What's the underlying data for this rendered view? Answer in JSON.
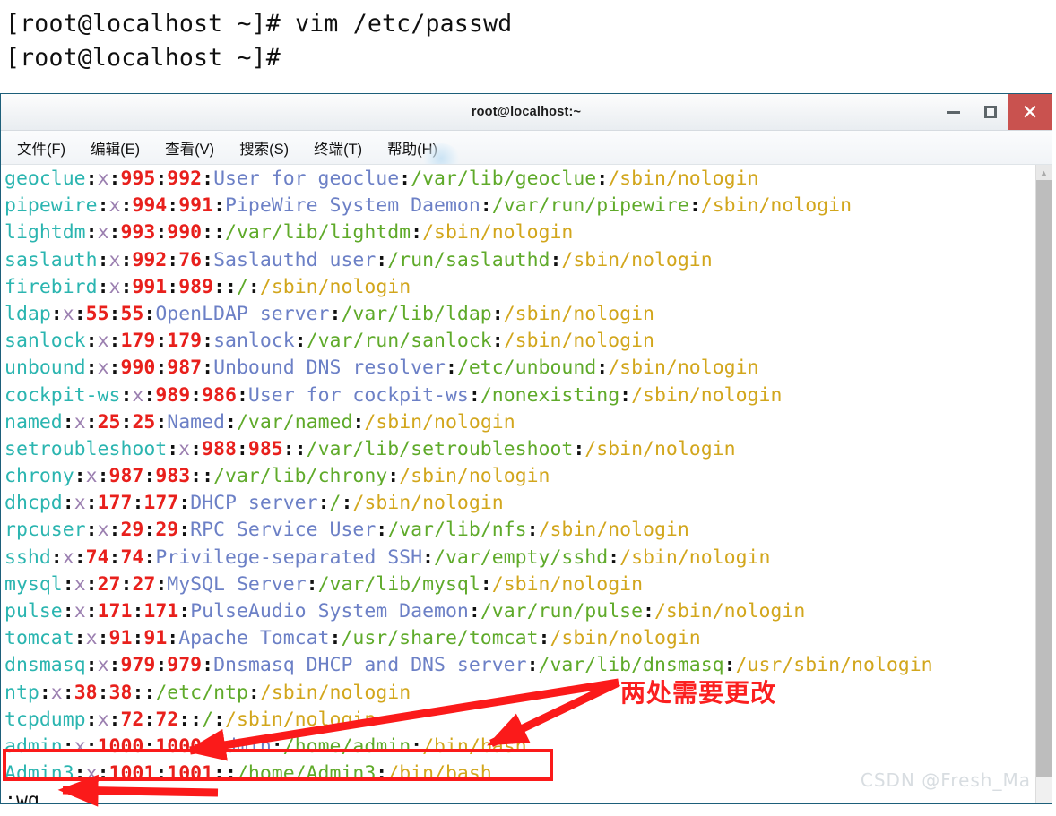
{
  "shell": {
    "line1": "[root@localhost ~]# vim /etc/passwd",
    "line2": "[root@localhost ~]#"
  },
  "window": {
    "title": "root@localhost:~",
    "controls": {
      "minimize": "─",
      "maximize": "□",
      "close": "✕"
    }
  },
  "menu": {
    "items": [
      {
        "label": "文件(F)"
      },
      {
        "label": "编辑(E)"
      },
      {
        "label": "查看(V)"
      },
      {
        "label": "搜索(S)"
      },
      {
        "label": "终端(T)"
      },
      {
        "label": "帮助(H)"
      }
    ]
  },
  "scrollbar": {
    "up_arrow": "▲"
  },
  "terminal": {
    "lines": [
      {
        "user": "geoclue",
        "pw": "x",
        "uid": "995",
        "gid": "992",
        "comment": "User for geoclue",
        "home": "/var/lib/geoclue",
        "shell": "/sbin/nologin"
      },
      {
        "user": "pipewire",
        "pw": "x",
        "uid": "994",
        "gid": "991",
        "comment": "PipeWire System Daemon",
        "home": "/var/run/pipewire",
        "shell": "/sbin/nologin"
      },
      {
        "user": "lightdm",
        "pw": "x",
        "uid": "993",
        "gid": "990",
        "comment": "",
        "home": "/var/lib/lightdm",
        "shell": "/sbin/nologin"
      },
      {
        "user": "saslauth",
        "pw": "x",
        "uid": "992",
        "gid": "76",
        "comment": "Saslauthd user",
        "home": "/run/saslauthd",
        "shell": "/sbin/nologin"
      },
      {
        "user": "firebird",
        "pw": "x",
        "uid": "991",
        "gid": "989",
        "comment": "",
        "home": "/",
        "shell": "/sbin/nologin"
      },
      {
        "user": "ldap",
        "pw": "x",
        "uid": "55",
        "gid": "55",
        "comment": "OpenLDAP server",
        "home": "/var/lib/ldap",
        "shell": "/sbin/nologin"
      },
      {
        "user": "sanlock",
        "pw": "x",
        "uid": "179",
        "gid": "179",
        "comment": "sanlock",
        "home": "/var/run/sanlock",
        "shell": "/sbin/nologin"
      },
      {
        "user": "unbound",
        "pw": "x",
        "uid": "990",
        "gid": "987",
        "comment": "Unbound DNS resolver",
        "home": "/etc/unbound",
        "shell": "/sbin/nologin"
      },
      {
        "user": "cockpit-ws",
        "pw": "x",
        "uid": "989",
        "gid": "986",
        "comment": "User for cockpit-ws",
        "home": "/nonexisting",
        "shell": "/sbin/nologin"
      },
      {
        "user": "named",
        "pw": "x",
        "uid": "25",
        "gid": "25",
        "comment": "Named",
        "home": "/var/named",
        "shell": "/sbin/nologin"
      },
      {
        "user": "setroubleshoot",
        "pw": "x",
        "uid": "988",
        "gid": "985",
        "comment": "",
        "home": "/var/lib/setroubleshoot",
        "shell": "/sbin/nologin"
      },
      {
        "user": "chrony",
        "pw": "x",
        "uid": "987",
        "gid": "983",
        "comment": "",
        "home": "/var/lib/chrony",
        "shell": "/sbin/nologin"
      },
      {
        "user": "dhcpd",
        "pw": "x",
        "uid": "177",
        "gid": "177",
        "comment": "DHCP server",
        "home": "/",
        "shell": "/sbin/nologin"
      },
      {
        "user": "rpcuser",
        "pw": "x",
        "uid": "29",
        "gid": "29",
        "comment": "RPC Service User",
        "home": "/var/lib/nfs",
        "shell": "/sbin/nologin"
      },
      {
        "user": "sshd",
        "pw": "x",
        "uid": "74",
        "gid": "74",
        "comment": "Privilege-separated SSH",
        "home": "/var/empty/sshd",
        "shell": "/sbin/nologin"
      },
      {
        "user": "mysql",
        "pw": "x",
        "uid": "27",
        "gid": "27",
        "comment": "MySQL Server",
        "home": "/var/lib/mysql",
        "shell": "/sbin/nologin"
      },
      {
        "user": "pulse",
        "pw": "x",
        "uid": "171",
        "gid": "171",
        "comment": "PulseAudio System Daemon",
        "home": "/var/run/pulse",
        "shell": "/sbin/nologin"
      },
      {
        "user": "tomcat",
        "pw": "x",
        "uid": "91",
        "gid": "91",
        "comment": "Apache Tomcat",
        "home": "/usr/share/tomcat",
        "shell": "/sbin/nologin"
      },
      {
        "user": "dnsmasq",
        "pw": "x",
        "uid": "979",
        "gid": "979",
        "comment": "Dnsmasq DHCP and DNS server",
        "home": "/var/lib/dnsmasq",
        "shell": "/usr/sbin/nologin"
      },
      {
        "user": "ntp",
        "pw": "x",
        "uid": "38",
        "gid": "38",
        "comment": "",
        "home": "/etc/ntp",
        "shell": "/sbin/nologin"
      },
      {
        "user": "tcpdump",
        "pw": "x",
        "uid": "72",
        "gid": "72",
        "comment": "",
        "home": "/",
        "shell": "/sbin/nologin"
      },
      {
        "user": "admin",
        "pw": "x",
        "uid": "1000",
        "gid": "1000",
        "comment": "Admin",
        "home": "/home/admin",
        "shell": "/bin/bash"
      },
      {
        "user": "Admin3",
        "pw": "x",
        "uid": "1001",
        "gid": "1001",
        "comment": "",
        "home": "/home/Admin3",
        "shell": "/bin/bash"
      }
    ],
    "status_line": ":wq"
  },
  "annotations": {
    "note": "两处需要更改",
    "note_color": "#fb2020",
    "box_color": "#fb1a1a"
  },
  "watermark": "CSDN @Fresh_Ma"
}
